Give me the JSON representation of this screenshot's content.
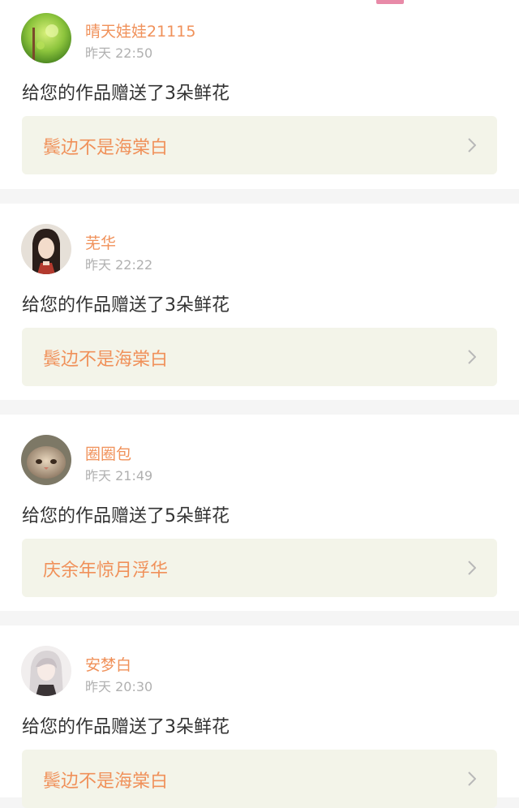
{
  "colors": {
    "accent": "#f0915a",
    "tab_indicator": "#e88aa8",
    "time_gray": "#b0b0b0",
    "link_bg": "#f3f4e9",
    "text": "#333333"
  },
  "notifications": [
    {
      "username": "晴天娃娃21115",
      "time": "昨天 22:50",
      "message": "给您的作品赠送了3朵鲜花",
      "work_title": "鬓边不是海棠白",
      "avatar_icon": "green-forest-avatar"
    },
    {
      "username": "芜华",
      "time": "昨天 22:22",
      "message": "给您的作品赠送了3朵鲜花",
      "work_title": "鬓边不是海棠白",
      "avatar_icon": "ancient-man-avatar"
    },
    {
      "username": "圈圈包",
      "time": "昨天 21:49",
      "message": "给您的作品赠送了5朵鲜花",
      "work_title": "庆余年惊月浮华",
      "avatar_icon": "cat-avatar"
    },
    {
      "username": "安梦白",
      "time": "昨天 20:30",
      "message": "给您的作品赠送了3朵鲜花",
      "work_title": "鬓边不是海棠白",
      "avatar_icon": "anime-girl-avatar"
    }
  ]
}
